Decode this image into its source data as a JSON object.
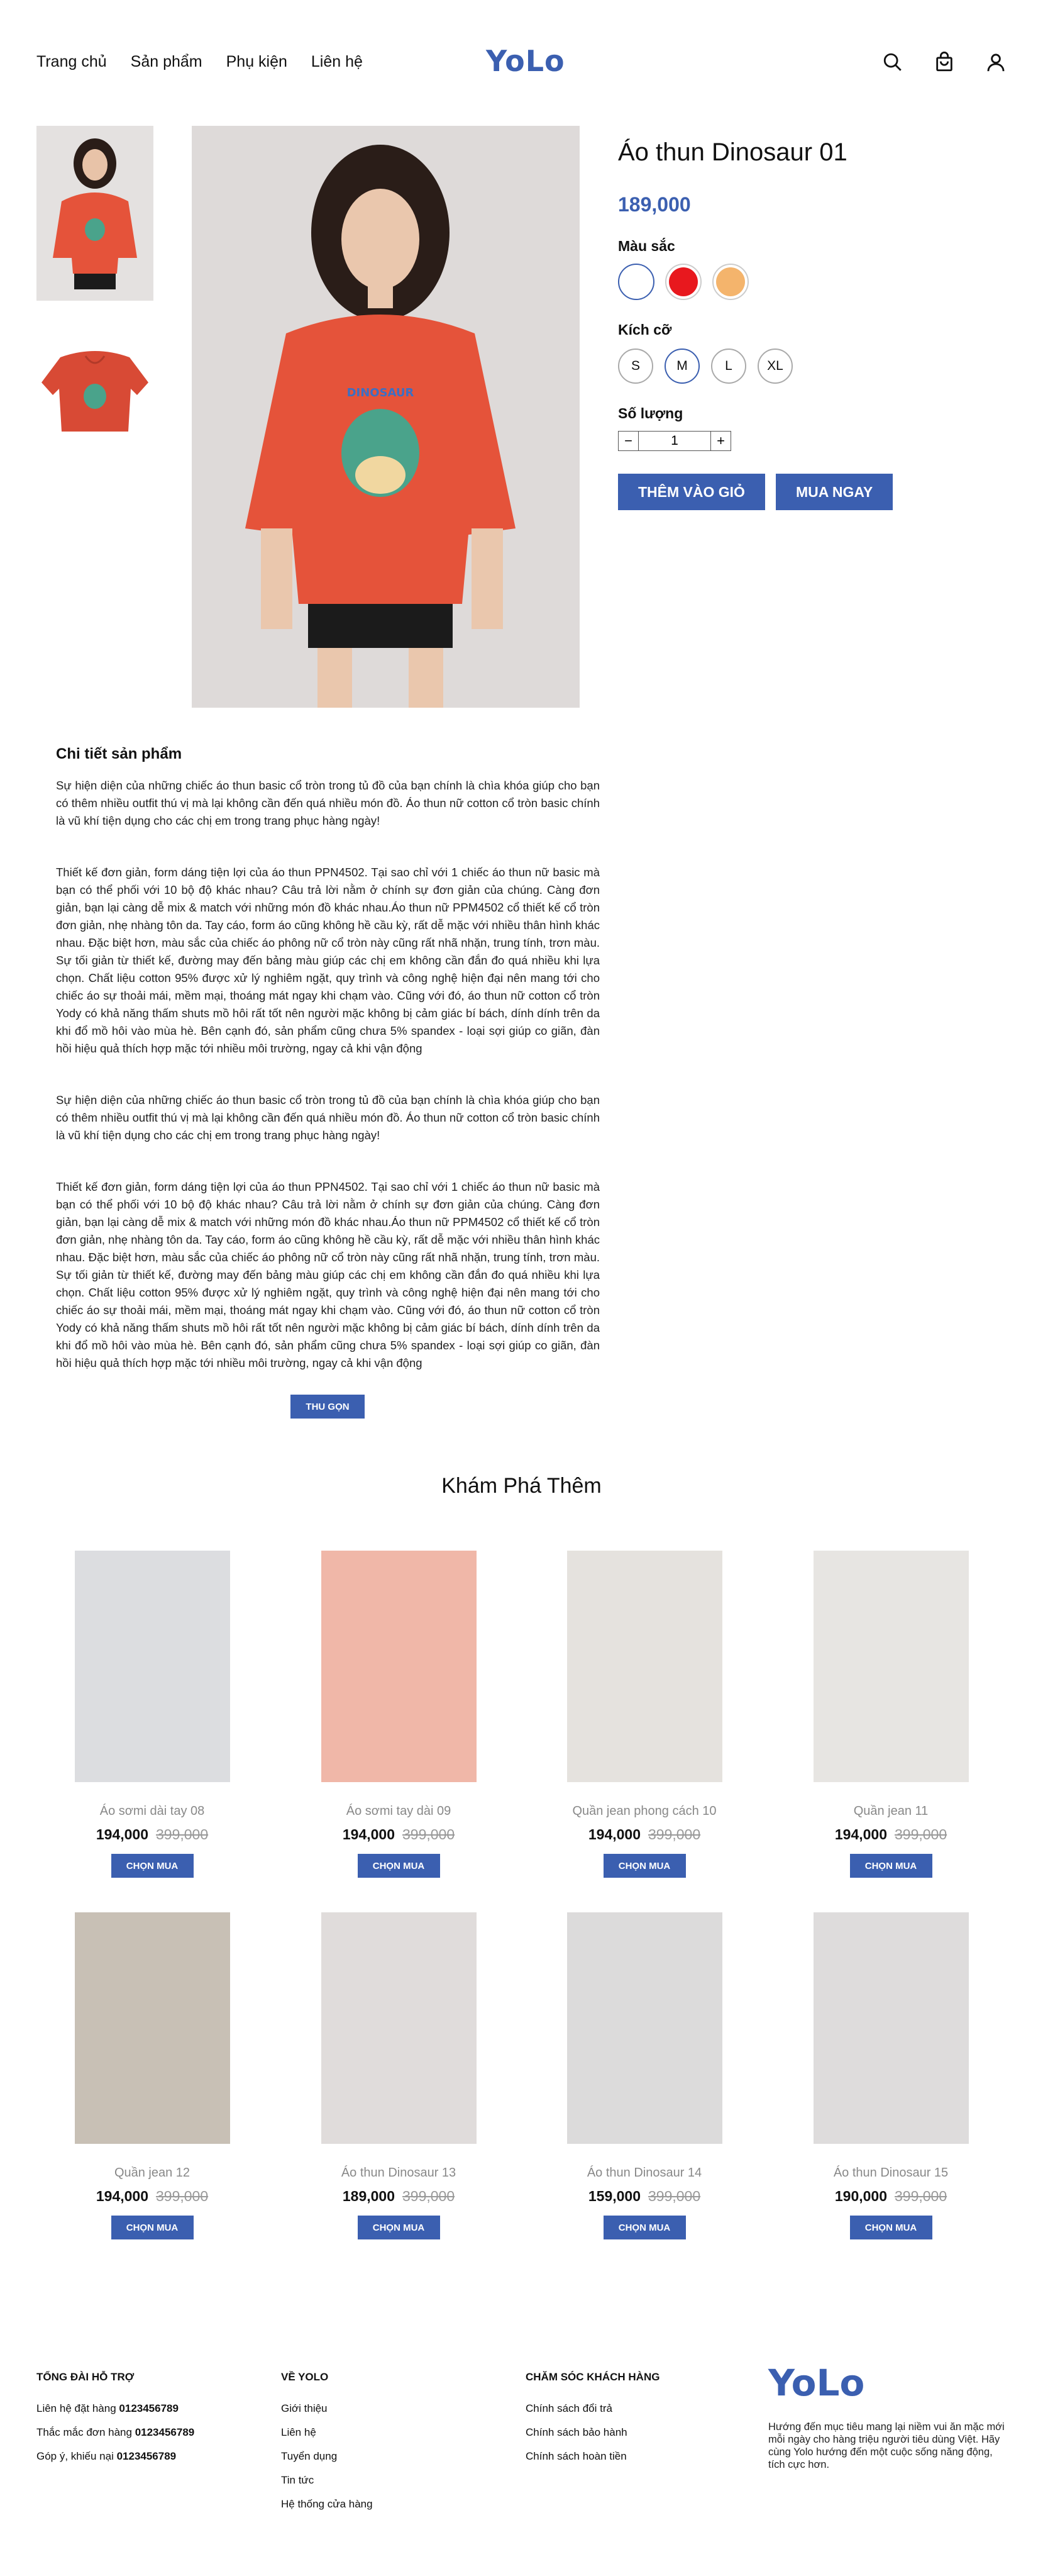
{
  "header": {
    "nav": [
      "Trang chủ",
      "Sản phẩm",
      "Phụ kiện",
      "Liên hệ"
    ],
    "logo": "YoLo",
    "icons": [
      "search-icon",
      "bag-icon",
      "user-icon"
    ]
  },
  "product": {
    "title": "Áo thun Dinosaur 01",
    "price": "189,000",
    "color_label": "Màu sắc",
    "colors": [
      "#ffffff",
      "#e8181e",
      "#f4b46c"
    ],
    "size_label": "Kích cỡ",
    "sizes": [
      "S",
      "M",
      "L",
      "XL"
    ],
    "selected_size": "M",
    "qty_label": "Số lượng",
    "qty": "1",
    "add_to_cart": "THÊM VÀO GIỎ",
    "buy_now": "MUA NGAY"
  },
  "details": {
    "heading": "Chi tiết sản phẩm",
    "p1": "Sự hiện diện của những chiếc áo thun basic cổ tròn trong tủ đồ của bạn chính là chìa khóa giúp cho bạn có thêm nhiều outfit thú vị mà lại không cần đến quá nhiều món đồ. Áo thun nữ cotton cổ tròn basic chính là vũ khí tiện dụng cho các chị em trong trang phục hàng ngày!",
    "p2": "Thiết kế đơn giản, form dáng tiện lợi của áo thun PPN4502. Tại sao chỉ với 1 chiếc áo thun nữ basic mà bạn có thể phối với 10 bộ độ khác nhau? Câu trả lời nằm ở chính sự đơn giản của chúng. Càng đơn giản, bạn lại càng dễ mix & match với những món đồ khác nhau.Áo thun nữ PPM4502 cổ thiết kế cổ tròn đơn giản, nhẹ nhàng tôn da. Tay cáo, form áo cũng không hề cầu kỳ, rất dễ mặc với nhiều thân hình khác nhau. Đặc biệt hơn, màu sắc của chiếc áo phông nữ cổ tròn này cũng rất nhã nhặn, trung tính, trơn màu. Sự tối giản từ thiết kế, đường may đến bảng màu giúp các chị em không cần đắn đo quá nhiều khi lựa chọn. Chất liệu cotton 95% được xử lý nghiêm ngặt, quy trình và công nghệ hiện đại nên mang tới cho chiếc áo sự thoải mái, mềm mại, thoáng mát ngay khi chạm vào. Cũng với đó, áo thun nữ cotton cổ tròn Yody có khả năng thấm shuts mồ hôi rất tốt nên người mặc không bị cảm giác bí bách, dính dính trên da khi đổ mồ hôi vào mùa hè. Bên cạnh đó, sản phẩm cũng chưa 5% spandex - loại sợi giúp co giãn, đàn hồi hiệu quả thích hợp mặc tới nhiều môi trường, ngay cả khi vận động",
    "p3": "Sự hiện diện của những chiếc áo thun basic cổ tròn trong tủ đồ của bạn chính là chìa khóa giúp cho bạn có thêm nhiều outfit thú vị mà lại không cần đến quá nhiều món đồ. Áo thun nữ cotton cổ tròn basic chính là vũ khí tiện dụng cho các chị em trong trang phục hàng ngày!",
    "p4": "Thiết kế đơn giản, form dáng tiện lợi của áo thun PPN4502. Tại sao chỉ với 1 chiếc áo thun nữ basic mà bạn có thể phối với 10 bộ độ khác nhau? Câu trả lời nằm ở chính sự đơn giản của chúng. Càng đơn giản, bạn lại càng dễ mix & match với những món đồ khác nhau.Áo thun nữ PPM4502 cổ thiết kế cổ tròn đơn giản, nhẹ nhàng tôn da. Tay cáo, form áo cũng không hề cầu kỳ, rất dễ mặc với nhiều thân hình khác nhau. Đặc biệt hơn, màu sắc của chiếc áo phông nữ cổ tròn này cũng rất nhã nhặn, trung tính, trơn màu. Sự tối giản từ thiết kế, đường may đến bảng màu giúp các chị em không cần đắn đo quá nhiều khi lựa chọn. Chất liệu cotton 95% được xử lý nghiêm ngặt, quy trình và công nghệ hiện đại nên mang tới cho chiếc áo sự thoải mái, mềm mại, thoáng mát ngay khi chạm vào. Cũng với đó, áo thun nữ cotton cổ tròn Yody có khả năng thấm shuts mồ hôi rất tốt nên người mặc không bị cảm giác bí bách, dính dính trên da khi đổ mồ hôi vào mùa hè. Bên cạnh đó, sản phẩm cũng chưa 5% spandex - loại sợi giúp co giãn, đàn hồi hiệu quả thích hợp mặc tới nhiều môi trường, ngay cả khi vận động",
    "collapse": "THU GỌN"
  },
  "explore": {
    "title": "Khám Phá Thêm",
    "choose_label": "CHỌN MUA",
    "items": [
      {
        "name": "Áo sơmi dài tay 08",
        "price": "194,000",
        "old": "399,000",
        "bg": "#dcdde0"
      },
      {
        "name": "Áo sơmi tay dài 09",
        "price": "194,000",
        "old": "399,000",
        "bg": "#f0b7a8"
      },
      {
        "name": "Quần jean phong cách 10",
        "price": "194,000",
        "old": "399,000",
        "bg": "#e5e2de"
      },
      {
        "name": "Quần jean 11",
        "price": "194,000",
        "old": "399,000",
        "bg": "#e7e5e2"
      },
      {
        "name": "Quần jean 12",
        "price": "194,000",
        "old": "399,000",
        "bg": "#c8c0b5"
      },
      {
        "name": "Áo thun Dinosaur 13",
        "price": "189,000",
        "old": "399,000",
        "bg": "#e0dcdb"
      },
      {
        "name": "Áo thun Dinosaur 14",
        "price": "159,000",
        "old": "399,000",
        "bg": "#dcdbdb"
      },
      {
        "name": "Áo thun Dinosaur 15",
        "price": "190,000",
        "old": "399,000",
        "bg": "#dedcdc"
      }
    ]
  },
  "footer": {
    "support": {
      "title": "TỔNG ĐÀI HỖ TRỢ",
      "lines": [
        {
          "label": "Liên hệ đặt hàng ",
          "phone": "0123456789"
        },
        {
          "label": "Thắc mắc đơn hàng ",
          "phone": "0123456789"
        },
        {
          "label": "Góp ý, khiếu nại ",
          "phone": "0123456789"
        }
      ]
    },
    "about": {
      "title": "VỀ YOLO",
      "links": [
        "Giới thiệu",
        "Liên hệ",
        "Tuyển dụng",
        "Tin tức",
        "Hệ thống cửa hàng"
      ]
    },
    "care": {
      "title": "CHĂM SÓC KHÁCH HÀNG",
      "links": [
        "Chính sách đổi trả",
        "Chính sách bảo hành",
        "Chính sách hoàn tiền"
      ]
    },
    "logo": "YoLo",
    "description": "Hướng đến mục tiêu mang lại niềm vui ăn mặc mới mỗi ngày cho hàng triệu người tiêu dùng Việt. Hãy cùng Yolo hướng đến một cuộc sống năng động, tích cực hơn."
  }
}
